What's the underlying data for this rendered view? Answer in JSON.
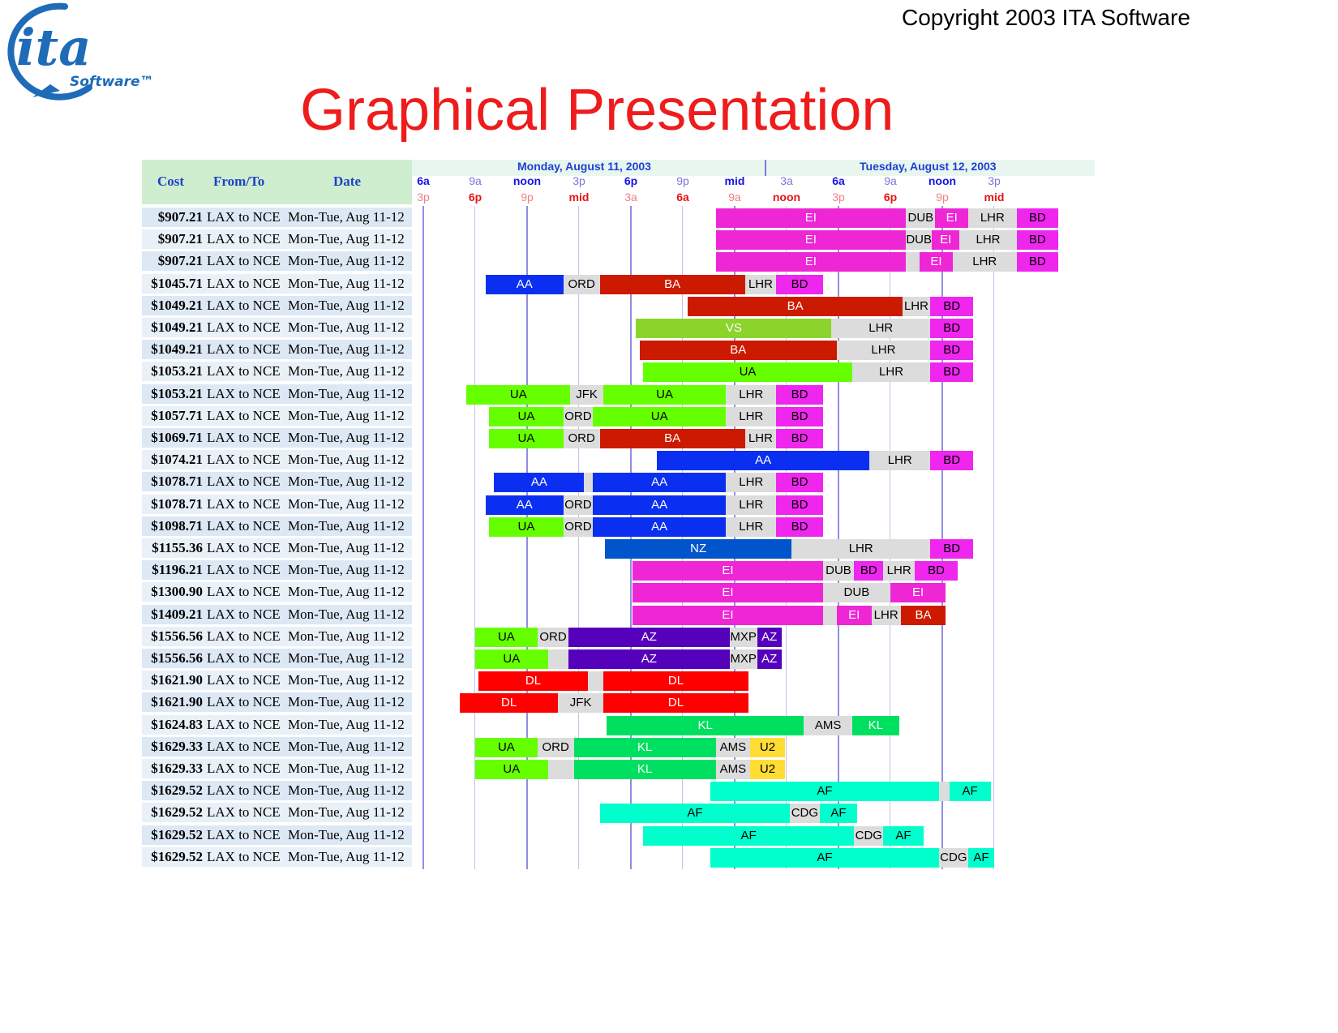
{
  "header": {
    "copyright": "Copyright 2003 ITA Software",
    "title": "Graphical Presentation",
    "logo": {
      "main": "ita",
      "sub": "Software™"
    }
  },
  "table_header": {
    "cost": "Cost",
    "from_to": "From/To",
    "date": "Date"
  },
  "dates": {
    "day1": "Monday, August 11, 2003",
    "day2": "Tuesday, August 12, 2003"
  },
  "time_axis": {
    "top": [
      "6a",
      "9a",
      "noon",
      "3p",
      "6p",
      "9p",
      "mid",
      "3a",
      "6a",
      "9a",
      "noon",
      "3p"
    ],
    "bottom": [
      "3p",
      "6p",
      "9p",
      "mid",
      "3a",
      "6a",
      "9a",
      "noon",
      "3p",
      "6p",
      "9p",
      "mid"
    ],
    "top_hours": [
      0,
      3,
      6,
      9,
      12,
      15,
      18,
      21,
      24,
      27,
      30,
      33
    ]
  },
  "colors": {
    "EI": "#ee26d6",
    "BD": "#ee26ee",
    "BA": "#cc1a00",
    "AA": "#0a2ff0",
    "UA": "#66ff00",
    "VS": "#8ad42c",
    "NZ": "#0055cc",
    "AZ": "#5500bb",
    "DL": "#ff0000",
    "KL": "#00e060",
    "U2": "#ffdd33",
    "AF": "#00ffcc",
    "connect": "#dcdcdc"
  },
  "rows": [
    {
      "cost": "$907.21",
      "route": "LAX to NCE",
      "date": "Mon-Tue, Aug 11-12",
      "segments": [
        {
          "t": "EI",
          "s": 16.9,
          "e": 27.9
        },
        {
          "t": "DUB",
          "s": 27.9,
          "e": 29.6,
          "c": 1
        },
        {
          "t": "EI",
          "s": 29.6,
          "e": 31.5
        },
        {
          "t": "LHR",
          "s": 31.5,
          "e": 34.3,
          "c": 1
        },
        {
          "t": "BD",
          "s": 34.3,
          "e": 36.7
        }
      ]
    },
    {
      "cost": "$907.21",
      "route": "LAX to NCE",
      "date": "Mon-Tue, Aug 11-12",
      "segments": [
        {
          "t": "EI",
          "s": 16.9,
          "e": 27.9
        },
        {
          "t": "DUB",
          "s": 27.9,
          "e": 29.4,
          "c": 1
        },
        {
          "t": "EI",
          "s": 29.4,
          "e": 31.0
        },
        {
          "t": "LHR",
          "s": 31.0,
          "e": 34.3,
          "c": 1
        },
        {
          "t": "BD",
          "s": 34.3,
          "e": 36.7
        }
      ]
    },
    {
      "cost": "$907.21",
      "route": "LAX to NCE",
      "date": "Mon-Tue, Aug 11-12",
      "segments": [
        {
          "t": "EI",
          "s": 16.9,
          "e": 27.9
        },
        {
          "t": "",
          "s": 27.9,
          "e": 28.7,
          "c": 1
        },
        {
          "t": "EI",
          "s": 28.7,
          "e": 30.6
        },
        {
          "t": "LHR",
          "s": 30.6,
          "e": 34.3,
          "c": 1
        },
        {
          "t": "BD",
          "s": 34.3,
          "e": 36.7
        }
      ]
    },
    {
      "cost": "$1045.71",
      "route": "LAX to NCE",
      "date": "Mon-Tue, Aug 11-12",
      "segments": [
        {
          "t": "AA",
          "s": 3.6,
          "e": 8.1
        },
        {
          "t": "ORD",
          "s": 8.1,
          "e": 10.2,
          "c": 1
        },
        {
          "t": "BA",
          "s": 10.2,
          "e": 18.6
        },
        {
          "t": "LHR",
          "s": 18.6,
          "e": 20.4,
          "c": 1
        },
        {
          "t": "BD",
          "s": 20.4,
          "e": 23.1
        }
      ]
    },
    {
      "cost": "$1049.21",
      "route": "LAX to NCE",
      "date": "Mon-Tue, Aug 11-12",
      "segments": [
        {
          "t": "BA",
          "s": 15.3,
          "e": 27.7
        },
        {
          "t": "LHR",
          "s": 27.7,
          "e": 29.3,
          "c": 1
        },
        {
          "t": "BD",
          "s": 29.3,
          "e": 31.8
        }
      ]
    },
    {
      "cost": "$1049.21",
      "route": "LAX to NCE",
      "date": "Mon-Tue, Aug 11-12",
      "segments": [
        {
          "t": "VS",
          "s": 12.3,
          "e": 23.6
        },
        {
          "t": "LHR",
          "s": 23.6,
          "e": 29.3,
          "c": 1
        },
        {
          "t": "BD",
          "s": 29.3,
          "e": 31.8
        }
      ]
    },
    {
      "cost": "$1049.21",
      "route": "LAX to NCE",
      "date": "Mon-Tue, Aug 11-12",
      "segments": [
        {
          "t": "BA",
          "s": 12.5,
          "e": 23.9
        },
        {
          "t": "LHR",
          "s": 23.9,
          "e": 29.3,
          "c": 1
        },
        {
          "t": "BD",
          "s": 29.3,
          "e": 31.8
        }
      ]
    },
    {
      "cost": "$1053.21",
      "route": "LAX to NCE",
      "date": "Mon-Tue, Aug 11-12",
      "segments": [
        {
          "t": "UA",
          "s": 12.7,
          "e": 24.8
        },
        {
          "t": "LHR",
          "s": 24.8,
          "e": 29.3,
          "c": 1
        },
        {
          "t": "BD",
          "s": 29.3,
          "e": 31.8
        }
      ]
    },
    {
      "cost": "$1053.21",
      "route": "LAX to NCE",
      "date": "Mon-Tue, Aug 11-12",
      "segments": [
        {
          "t": "UA",
          "s": 2.5,
          "e": 8.5
        },
        {
          "t": "JFK",
          "s": 8.5,
          "e": 10.4,
          "c": 1
        },
        {
          "t": "UA",
          "s": 10.4,
          "e": 17.5
        },
        {
          "t": "LHR",
          "s": 17.5,
          "e": 20.4,
          "c": 1
        },
        {
          "t": "BD",
          "s": 20.4,
          "e": 23.1
        }
      ]
    },
    {
      "cost": "$1057.71",
      "route": "LAX to NCE",
      "date": "Mon-Tue, Aug 11-12",
      "segments": [
        {
          "t": "UA",
          "s": 3.8,
          "e": 8.1
        },
        {
          "t": "ORD",
          "s": 8.1,
          "e": 9.8,
          "c": 1
        },
        {
          "t": "UA",
          "s": 9.8,
          "e": 17.5
        },
        {
          "t": "LHR",
          "s": 17.5,
          "e": 20.4,
          "c": 1
        },
        {
          "t": "BD",
          "s": 20.4,
          "e": 23.1
        }
      ]
    },
    {
      "cost": "$1069.71",
      "route": "LAX to NCE",
      "date": "Mon-Tue, Aug 11-12",
      "segments": [
        {
          "t": "UA",
          "s": 3.8,
          "e": 8.1
        },
        {
          "t": "ORD",
          "s": 8.1,
          "e": 10.2,
          "c": 1
        },
        {
          "t": "BA",
          "s": 10.2,
          "e": 18.6
        },
        {
          "t": "LHR",
          "s": 18.6,
          "e": 20.4,
          "c": 1
        },
        {
          "t": "BD",
          "s": 20.4,
          "e": 23.1
        }
      ]
    },
    {
      "cost": "$1074.21",
      "route": "LAX to NCE",
      "date": "Mon-Tue, Aug 11-12",
      "segments": [
        {
          "t": "AA",
          "s": 13.5,
          "e": 25.8
        },
        {
          "t": "LHR",
          "s": 25.8,
          "e": 29.3,
          "c": 1
        },
        {
          "t": "BD",
          "s": 29.3,
          "e": 31.8
        }
      ]
    },
    {
      "cost": "$1078.71",
      "route": "LAX to NCE",
      "date": "Mon-Tue, Aug 11-12",
      "segments": [
        {
          "t": "AA",
          "s": 4.1,
          "e": 9.3
        },
        {
          "t": "",
          "s": 9.3,
          "e": 9.8,
          "c": 1
        },
        {
          "t": "AA",
          "s": 9.8,
          "e": 17.5
        },
        {
          "t": "LHR",
          "s": 17.5,
          "e": 20.4,
          "c": 1
        },
        {
          "t": "BD",
          "s": 20.4,
          "e": 23.1
        }
      ]
    },
    {
      "cost": "$1078.71",
      "route": "LAX to NCE",
      "date": "Mon-Tue, Aug 11-12",
      "segments": [
        {
          "t": "AA",
          "s": 3.6,
          "e": 8.1
        },
        {
          "t": "ORD",
          "s": 8.1,
          "e": 9.8,
          "c": 1
        },
        {
          "t": "AA",
          "s": 9.8,
          "e": 17.5
        },
        {
          "t": "LHR",
          "s": 17.5,
          "e": 20.4,
          "c": 1
        },
        {
          "t": "BD",
          "s": 20.4,
          "e": 23.1
        }
      ]
    },
    {
      "cost": "$1098.71",
      "route": "LAX to NCE",
      "date": "Mon-Tue, Aug 11-12",
      "segments": [
        {
          "t": "UA",
          "s": 3.8,
          "e": 8.1
        },
        {
          "t": "ORD",
          "s": 8.1,
          "e": 9.8,
          "c": 1
        },
        {
          "t": "AA",
          "s": 9.8,
          "e": 17.5
        },
        {
          "t": "LHR",
          "s": 17.5,
          "e": 20.4,
          "c": 1
        },
        {
          "t": "BD",
          "s": 20.4,
          "e": 23.1
        }
      ]
    },
    {
      "cost": "$1155.36",
      "route": "LAX to NCE",
      "date": "Mon-Tue, Aug 11-12",
      "segments": [
        {
          "t": "NZ",
          "s": 10.5,
          "e": 21.3
        },
        {
          "t": "LHR",
          "s": 21.3,
          "e": 29.3,
          "c": 1
        },
        {
          "t": "BD",
          "s": 29.3,
          "e": 31.8
        }
      ]
    },
    {
      "cost": "$1196.21",
      "route": "LAX to NCE",
      "date": "Mon-Tue, Aug 11-12",
      "segments": [
        {
          "t": "EI",
          "s": 12.1,
          "e": 23.1
        },
        {
          "t": "DUB",
          "s": 23.1,
          "e": 24.9,
          "c": 1
        },
        {
          "t": "BD",
          "s": 24.9,
          "e": 26.6
        },
        {
          "t": "LHR",
          "s": 26.6,
          "e": 28.4,
          "c": 1
        },
        {
          "t": "BD",
          "s": 28.4,
          "e": 30.9
        }
      ]
    },
    {
      "cost": "$1300.90",
      "route": "LAX to NCE",
      "date": "Mon-Tue, Aug 11-12",
      "segments": [
        {
          "t": "EI",
          "s": 12.1,
          "e": 23.1
        },
        {
          "t": "DUB",
          "s": 23.1,
          "e": 27.0,
          "c": 1
        },
        {
          "t": "EI",
          "s": 27.0,
          "e": 30.2
        }
      ]
    },
    {
      "cost": "$1409.21",
      "route": "LAX to NCE",
      "date": "Mon-Tue, Aug 11-12",
      "segments": [
        {
          "t": "EI",
          "s": 12.1,
          "e": 23.1
        },
        {
          "t": "",
          "s": 23.1,
          "e": 23.9,
          "c": 1
        },
        {
          "t": "EI",
          "s": 23.9,
          "e": 25.9
        },
        {
          "t": "LHR",
          "s": 25.9,
          "e": 27.6,
          "c": 1
        },
        {
          "t": "BA",
          "s": 27.6,
          "e": 30.2
        }
      ]
    },
    {
      "cost": "$1556.56",
      "route": "LAX to NCE",
      "date": "Mon-Tue, Aug 11-12",
      "segments": [
        {
          "t": "UA",
          "s": 3.0,
          "e": 6.6
        },
        {
          "t": "ORD",
          "s": 6.6,
          "e": 8.4,
          "c": 1
        },
        {
          "t": "AZ",
          "s": 8.4,
          "e": 17.7
        },
        {
          "t": "MXP",
          "s": 17.7,
          "e": 19.3,
          "c": 1
        },
        {
          "t": "AZ",
          "s": 19.3,
          "e": 20.7
        }
      ]
    },
    {
      "cost": "$1556.56",
      "route": "LAX to NCE",
      "date": "Mon-Tue, Aug 11-12",
      "segments": [
        {
          "t": "UA",
          "s": 3.0,
          "e": 7.2
        },
        {
          "t": "",
          "s": 7.2,
          "e": 8.4,
          "c": 1
        },
        {
          "t": "AZ",
          "s": 8.4,
          "e": 17.7
        },
        {
          "t": "MXP",
          "s": 17.7,
          "e": 19.3,
          "c": 1
        },
        {
          "t": "AZ",
          "s": 19.3,
          "e": 20.7
        }
      ]
    },
    {
      "cost": "$1621.90",
      "route": "LAX to NCE",
      "date": "Mon-Tue, Aug 11-12",
      "segments": [
        {
          "t": "DL",
          "s": 3.2,
          "e": 9.5
        },
        {
          "t": "",
          "s": 9.5,
          "e": 10.4,
          "c": 1
        },
        {
          "t": "DL",
          "s": 10.4,
          "e": 18.8
        }
      ]
    },
    {
      "cost": "$1621.90",
      "route": "LAX to NCE",
      "date": "Mon-Tue, Aug 11-12",
      "segments": [
        {
          "t": "DL",
          "s": 2.1,
          "e": 7.8
        },
        {
          "t": "JFK",
          "s": 7.8,
          "e": 10.4,
          "c": 1
        },
        {
          "t": "DL",
          "s": 10.4,
          "e": 18.8
        }
      ]
    },
    {
      "cost": "$1624.83",
      "route": "LAX to NCE",
      "date": "Mon-Tue, Aug 11-12",
      "segments": [
        {
          "t": "KL",
          "s": 10.6,
          "e": 22.0
        },
        {
          "t": "AMS",
          "s": 22.0,
          "e": 24.8,
          "c": 1
        },
        {
          "t": "KL",
          "s": 24.8,
          "e": 27.5
        }
      ]
    },
    {
      "cost": "$1629.33",
      "route": "LAX to NCE",
      "date": "Mon-Tue, Aug 11-12",
      "segments": [
        {
          "t": "UA",
          "s": 3.0,
          "e": 6.6
        },
        {
          "t": "ORD",
          "s": 6.6,
          "e": 8.7,
          "c": 1
        },
        {
          "t": "KL",
          "s": 8.7,
          "e": 16.9
        },
        {
          "t": "AMS",
          "s": 16.9,
          "e": 18.9,
          "c": 1
        },
        {
          "t": "U2",
          "s": 18.9,
          "e": 20.9
        }
      ]
    },
    {
      "cost": "$1629.33",
      "route": "LAX to NCE",
      "date": "Mon-Tue, Aug 11-12",
      "segments": [
        {
          "t": "UA",
          "s": 3.0,
          "e": 7.2
        },
        {
          "t": "",
          "s": 7.2,
          "e": 8.7,
          "c": 1
        },
        {
          "t": "KL",
          "s": 8.7,
          "e": 16.9
        },
        {
          "t": "AMS",
          "s": 16.9,
          "e": 18.9,
          "c": 1
        },
        {
          "t": "U2",
          "s": 18.9,
          "e": 20.9
        }
      ]
    },
    {
      "cost": "$1629.52",
      "route": "LAX to NCE",
      "date": "Mon-Tue, Aug 11-12",
      "segments": [
        {
          "t": "AF",
          "s": 16.6,
          "e": 29.8
        },
        {
          "t": "",
          "s": 29.8,
          "e": 30.4,
          "c": 1
        },
        {
          "t": "AF",
          "s": 30.4,
          "e": 32.8
        }
      ]
    },
    {
      "cost": "$1629.52",
      "route": "LAX to NCE",
      "date": "Mon-Tue, Aug 11-12",
      "segments": [
        {
          "t": "AF",
          "s": 10.2,
          "e": 21.2
        },
        {
          "t": "CDG",
          "s": 21.2,
          "e": 22.9,
          "c": 1
        },
        {
          "t": "AF",
          "s": 22.9,
          "e": 25.1
        }
      ]
    },
    {
      "cost": "$1629.52",
      "route": "LAX to NCE",
      "date": "Mon-Tue, Aug 11-12",
      "segments": [
        {
          "t": "AF",
          "s": 12.7,
          "e": 24.9
        },
        {
          "t": "CDG",
          "s": 24.9,
          "e": 26.6,
          "c": 1
        },
        {
          "t": "AF",
          "s": 26.6,
          "e": 28.9
        }
      ]
    },
    {
      "cost": "$1629.52",
      "route": "LAX to NCE",
      "date": "Mon-Tue, Aug 11-12",
      "segments": [
        {
          "t": "AF",
          "s": 16.6,
          "e": 29.8
        },
        {
          "t": "CDG",
          "s": 29.8,
          "e": 31.5,
          "c": 1
        },
        {
          "t": "AF",
          "s": 31.5,
          "e": 33.0
        }
      ]
    }
  ]
}
